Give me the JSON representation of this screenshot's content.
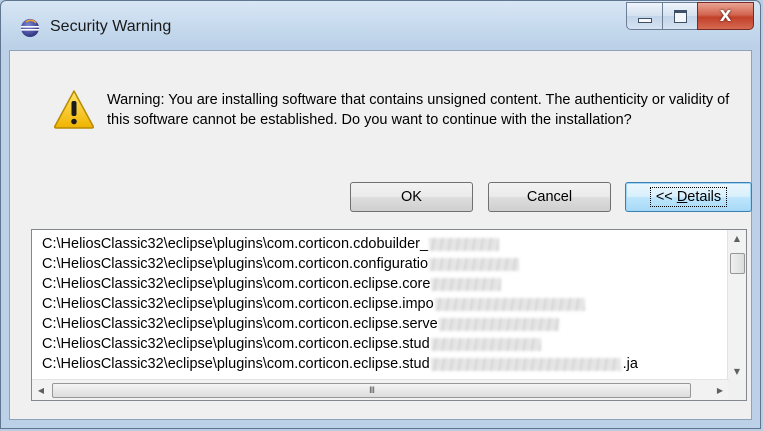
{
  "window": {
    "title": "Security Warning",
    "app_icon": "eclipse-icon",
    "controls": {
      "minimize_icon": "minimize-icon",
      "maximize_icon": "maximize-icon",
      "close_icon": "close-icon",
      "close_glyph": "X"
    }
  },
  "dialog": {
    "warning_icon": "warning-icon",
    "message": "Warning: You are installing software that contains unsigned content. The authenticity or validity of this software cannot be established. Do you want to continue with the installation?",
    "buttons": {
      "ok_label": "OK",
      "cancel_label": "Cancel",
      "details_prefix": "<< ",
      "details_mnemonic": "D",
      "details_rest": "etails"
    }
  },
  "details_list": {
    "rows": [
      {
        "text": "C:\\HeliosClassic32\\eclipse\\plugins\\com.corticon.cdobuilder_",
        "suffix": ""
      },
      {
        "text": "C:\\HeliosClassic32\\eclipse\\plugins\\com.corticon.configuratio",
        "suffix": ""
      },
      {
        "text": "C:\\HeliosClassic32\\eclipse\\plugins\\com.corticon.eclipse.core",
        "suffix": ""
      },
      {
        "text": "C:\\HeliosClassic32\\eclipse\\plugins\\com.corticon.eclipse.impo",
        "suffix": ""
      },
      {
        "text": "C:\\HeliosClassic32\\eclipse\\plugins\\com.corticon.eclipse.serve",
        "suffix": ""
      },
      {
        "text": "C:\\HeliosClassic32\\eclipse\\plugins\\com.corticon.eclipse.stud",
        "suffix": ""
      },
      {
        "text": "C:\\HeliosClassic32\\eclipse\\plugins\\com.corticon.eclipse.stud",
        "suffix": ".ja"
      }
    ],
    "hscroll_grip": "III",
    "scroll": {
      "up_arrow": "▲",
      "down_arrow": "▼",
      "left_arrow": "◀",
      "right_arrow": "▶"
    }
  },
  "colors": {
    "title_bar": "#c4d8ec",
    "close_button": "#c2402a",
    "dialog_background": "#f0f0f0",
    "details_button_focus": "#3c7fb1"
  }
}
